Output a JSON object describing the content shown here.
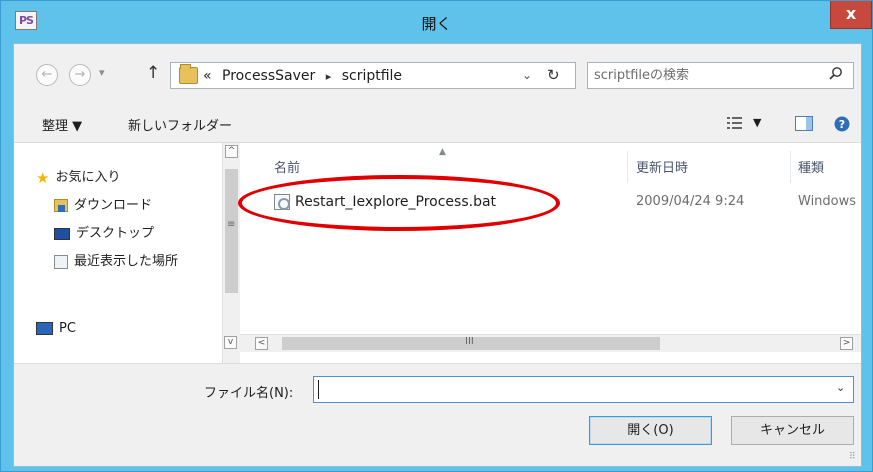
{
  "window": {
    "title": "開く",
    "app_icon_text": "PS",
    "close_label": "x"
  },
  "nav": {
    "back_icon": "back-arrow-icon",
    "forward_icon": "forward-arrow-icon",
    "address": {
      "overflow": "«",
      "segments": [
        "ProcessSaver",
        "scriptfile"
      ]
    },
    "search_placeholder": "scriptfileの検索"
  },
  "toolbar": {
    "organize_label": "整理 ▼",
    "new_folder_label": "新しいフォルダー"
  },
  "sidebar": {
    "items": [
      {
        "label": "お気に入り",
        "icon": "star-icon"
      },
      {
        "label": "ダウンロード",
        "icon": "download-folder-icon"
      },
      {
        "label": "デスクトップ",
        "icon": "desktop-icon"
      },
      {
        "label": "最近表示した場所",
        "icon": "recent-places-icon"
      },
      {
        "label": "PC",
        "icon": "pc-icon"
      }
    ]
  },
  "file_list": {
    "columns": [
      "名前",
      "更新日時",
      "種類"
    ],
    "rows": [
      {
        "name": "Restart_Iexplore_Process.bat",
        "modified": "2009/04/24 9:24",
        "type": "Windows"
      }
    ]
  },
  "footer": {
    "filename_label": "ファイル名(N):",
    "filename_value": "",
    "open_label": "開く(O)",
    "cancel_label": "キャンセル"
  },
  "colors": {
    "frame": "#5fc2ea",
    "close": "#c7493d",
    "highlight": "#e00000"
  }
}
